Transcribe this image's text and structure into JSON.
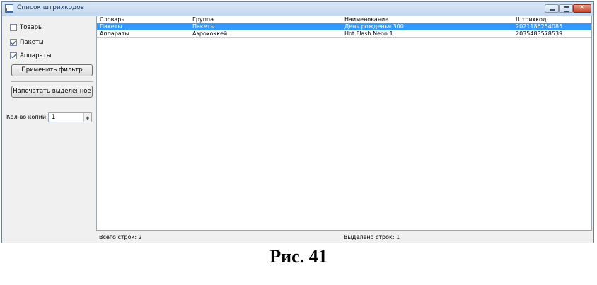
{
  "window": {
    "title": "Список штрихкодов"
  },
  "filters": [
    {
      "label": "Товары",
      "checked": false
    },
    {
      "label": "Пакеты",
      "checked": true
    },
    {
      "label": "Аппараты",
      "checked": true
    }
  ],
  "buttons": {
    "apply_filter": "Применить фильтр",
    "print_selected": "Напечатать выделенное"
  },
  "copies": {
    "label": "Кол-во копий:",
    "value": "1"
  },
  "table": {
    "columns": [
      "Словарь",
      "Группа",
      "Наименование",
      "Штрихкод"
    ],
    "rows": [
      {
        "dictionary": "Пакеты",
        "group": "Пакеты",
        "name": "День рожденья 300",
        "barcode": "2021186254085",
        "selected": true
      },
      {
        "dictionary": "Аппараты",
        "group": "Аэрохоккей",
        "name": "Hot Flash Neon 1",
        "barcode": "2035483578539",
        "selected": false
      }
    ]
  },
  "status": {
    "total": "Всего строк: 2",
    "selected": "Выделено строк: 1"
  },
  "caption": "Рис. 41",
  "colors": {
    "selection": "#3399ff",
    "close_button": "#c6452b"
  }
}
